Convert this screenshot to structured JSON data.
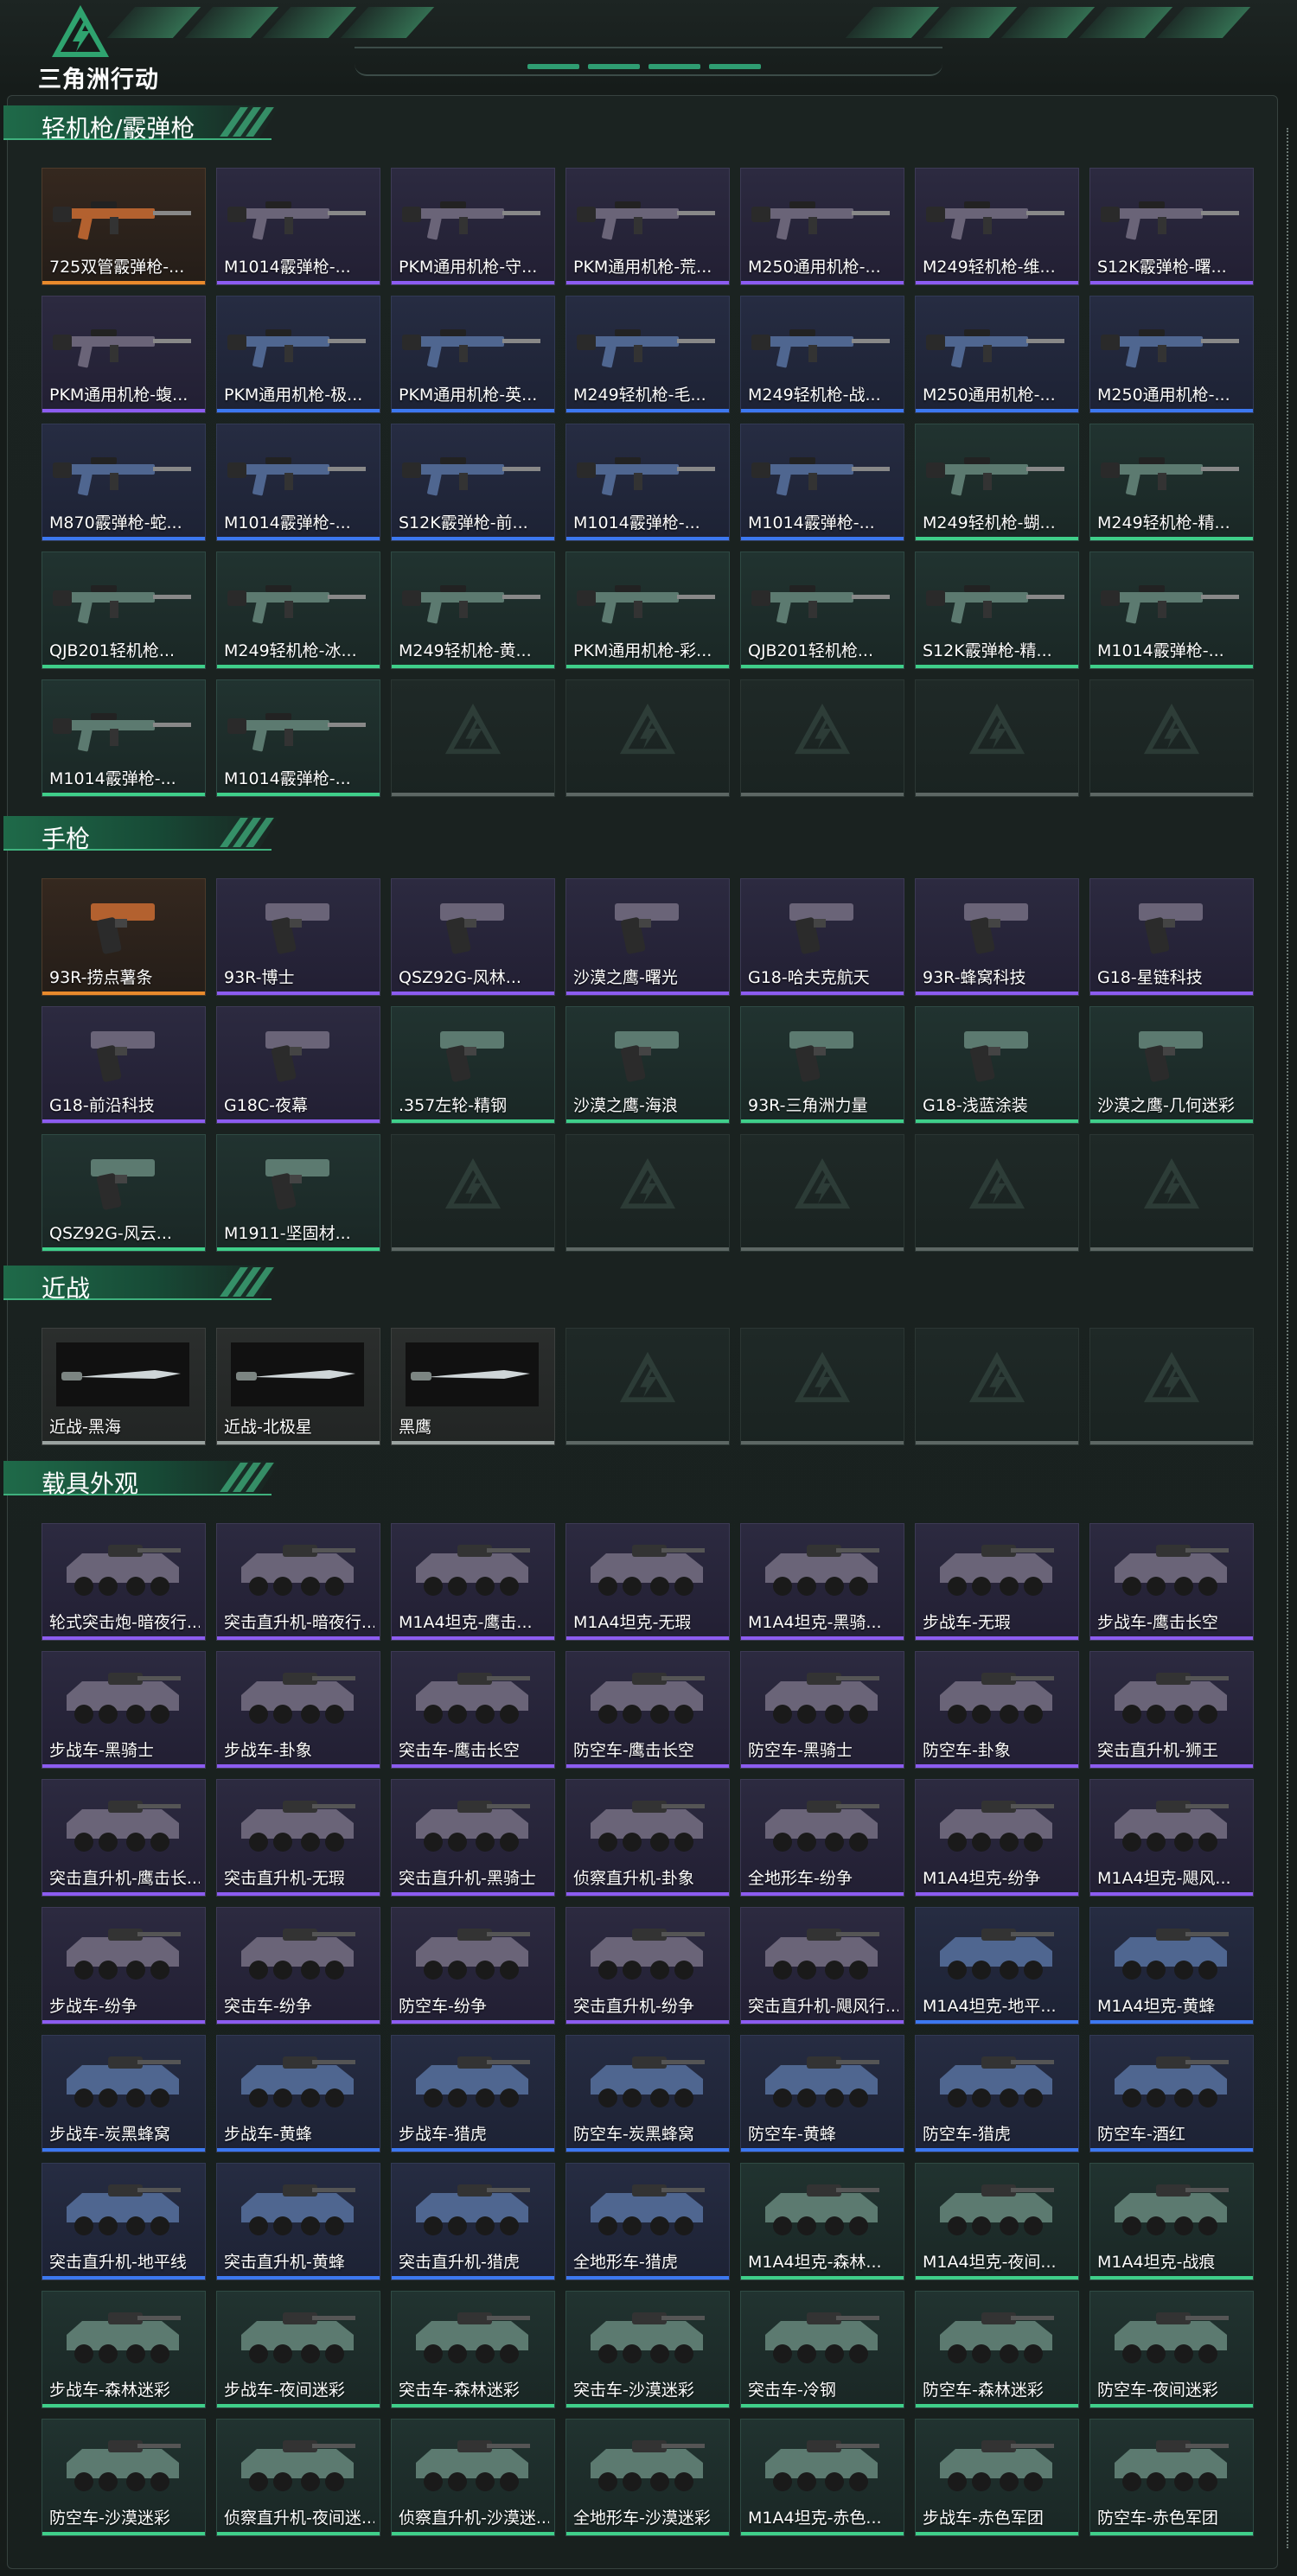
{
  "header": {
    "logo_text": "三角洲行动"
  },
  "colors": {
    "accent_green": "#3fb07d",
    "rarity_purple": "#8c5cf0",
    "rarity_blue": "#3c78f0",
    "rarity_green": "#3fcf8a",
    "rarity_orange": "#e88a2c"
  },
  "sections": [
    {
      "title": "轻机枪/霰弹枪",
      "icon": "rifle",
      "items": [
        {
          "name": "725双管霰弹枪-...",
          "rarity": "orange"
        },
        {
          "name": "M1014霰弹枪-...",
          "rarity": "purple"
        },
        {
          "name": "PKM通用机枪-守...",
          "rarity": "purple"
        },
        {
          "name": "PKM通用机枪-荒...",
          "rarity": "purple"
        },
        {
          "name": "M250通用机枪-...",
          "rarity": "purple"
        },
        {
          "name": "M249轻机枪-维...",
          "rarity": "purple"
        },
        {
          "name": "S12K霰弹枪-曙...",
          "rarity": "purple"
        },
        {
          "name": "PKM通用机枪-蝮...",
          "rarity": "purple"
        },
        {
          "name": "PKM通用机枪-极...",
          "rarity": "blue"
        },
        {
          "name": "PKM通用机枪-英...",
          "rarity": "blue"
        },
        {
          "name": "M249轻机枪-毛...",
          "rarity": "blue"
        },
        {
          "name": "M249轻机枪-战...",
          "rarity": "blue"
        },
        {
          "name": "M250通用机枪-...",
          "rarity": "blue"
        },
        {
          "name": "M250通用机枪-...",
          "rarity": "blue"
        },
        {
          "name": "M870霰弹枪-蛇...",
          "rarity": "blue"
        },
        {
          "name": "M1014霰弹枪-...",
          "rarity": "blue"
        },
        {
          "name": "S12K霰弹枪-前...",
          "rarity": "blue"
        },
        {
          "name": "M1014霰弹枪-...",
          "rarity": "blue"
        },
        {
          "name": "M1014霰弹枪-...",
          "rarity": "blue"
        },
        {
          "name": "M249轻机枪-蝴...",
          "rarity": "green"
        },
        {
          "name": "M249轻机枪-精...",
          "rarity": "green"
        },
        {
          "name": "QJB201轻机枪...",
          "rarity": "green"
        },
        {
          "name": "M249轻机枪-冰...",
          "rarity": "green"
        },
        {
          "name": "M249轻机枪-黄...",
          "rarity": "green"
        },
        {
          "name": "PKM通用机枪-彩...",
          "rarity": "green"
        },
        {
          "name": "QJB201轻机枪...",
          "rarity": "green"
        },
        {
          "name": "S12K霰弹枪-精...",
          "rarity": "green"
        },
        {
          "name": "M1014霰弹枪-...",
          "rarity": "green"
        },
        {
          "name": "M1014霰弹枪-...",
          "rarity": "green"
        },
        {
          "name": "M1014霰弹枪-...",
          "rarity": "green"
        }
      ],
      "empty_slots": 5
    },
    {
      "title": "手枪",
      "icon": "pistol",
      "items": [
        {
          "name": "93R-捞点薯条",
          "rarity": "orange"
        },
        {
          "name": "93R-博士",
          "rarity": "purple"
        },
        {
          "name": "QSZ92G-风林...",
          "rarity": "purple"
        },
        {
          "name": "沙漠之鹰-曙光",
          "rarity": "purple"
        },
        {
          "name": "G18-哈夫克航天",
          "rarity": "purple"
        },
        {
          "name": "93R-蜂窝科技",
          "rarity": "purple"
        },
        {
          "name": "G18-星链科技",
          "rarity": "purple"
        },
        {
          "name": "G18-前沿科技",
          "rarity": "purple"
        },
        {
          "name": "G18C-夜幕",
          "rarity": "purple"
        },
        {
          "name": ".357左轮-精钢",
          "rarity": "green"
        },
        {
          "name": "沙漠之鹰-海浪",
          "rarity": "green"
        },
        {
          "name": "93R-三角洲力量",
          "rarity": "green"
        },
        {
          "name": "G18-浅蓝涂装",
          "rarity": "green"
        },
        {
          "name": "沙漠之鹰-几何迷彩",
          "rarity": "green"
        },
        {
          "name": "QSZ92G-风云...",
          "rarity": "green"
        },
        {
          "name": "M1911-坚固材...",
          "rarity": "green"
        }
      ],
      "empty_slots": 5
    },
    {
      "title": "近战",
      "icon": "knife",
      "items": [
        {
          "name": "近战-黑海",
          "rarity": "gray"
        },
        {
          "name": "近战-北极星",
          "rarity": "gray"
        },
        {
          "name": "黑鹰",
          "rarity": "gray"
        }
      ],
      "empty_slots": 4
    },
    {
      "title": "载具外观",
      "icon": "vehicle",
      "items": [
        {
          "name": "轮式突击炮-暗夜行...",
          "rarity": "purple"
        },
        {
          "name": "突击直升机-暗夜行...",
          "rarity": "purple"
        },
        {
          "name": "M1A4坦克-鹰击...",
          "rarity": "purple"
        },
        {
          "name": "M1A4坦克-无瑕",
          "rarity": "purple"
        },
        {
          "name": "M1A4坦克-黑骑...",
          "rarity": "purple"
        },
        {
          "name": "步战车-无瑕",
          "rarity": "purple"
        },
        {
          "name": "步战车-鹰击长空",
          "rarity": "purple"
        },
        {
          "name": "步战车-黑骑士",
          "rarity": "purple"
        },
        {
          "name": "步战车-卦象",
          "rarity": "purple"
        },
        {
          "name": "突击车-鹰击长空",
          "rarity": "purple"
        },
        {
          "name": "防空车-鹰击长空",
          "rarity": "purple"
        },
        {
          "name": "防空车-黑骑士",
          "rarity": "purple"
        },
        {
          "name": "防空车-卦象",
          "rarity": "purple"
        },
        {
          "name": "突击直升机-狮王",
          "rarity": "purple"
        },
        {
          "name": "突击直升机-鹰击长...",
          "rarity": "purple"
        },
        {
          "name": "突击直升机-无瑕",
          "rarity": "purple"
        },
        {
          "name": "突击直升机-黑骑士",
          "rarity": "purple"
        },
        {
          "name": "侦察直升机-卦象",
          "rarity": "purple"
        },
        {
          "name": "全地形车-纷争",
          "rarity": "purple"
        },
        {
          "name": "M1A4坦克-纷争",
          "rarity": "purple"
        },
        {
          "name": "M1A4坦克-飓风...",
          "rarity": "purple"
        },
        {
          "name": "步战车-纷争",
          "rarity": "purple"
        },
        {
          "name": "突击车-纷争",
          "rarity": "purple"
        },
        {
          "name": "防空车-纷争",
          "rarity": "purple"
        },
        {
          "name": "突击直升机-纷争",
          "rarity": "purple"
        },
        {
          "name": "突击直升机-飓风行...",
          "rarity": "purple"
        },
        {
          "name": "M1A4坦克-地平...",
          "rarity": "blue"
        },
        {
          "name": "M1A4坦克-黄蜂",
          "rarity": "blue"
        },
        {
          "name": "步战车-炭黑蜂窝",
          "rarity": "blue"
        },
        {
          "name": "步战车-黄蜂",
          "rarity": "blue"
        },
        {
          "name": "步战车-猎虎",
          "rarity": "blue"
        },
        {
          "name": "防空车-炭黑蜂窝",
          "rarity": "blue"
        },
        {
          "name": "防空车-黄蜂",
          "rarity": "blue"
        },
        {
          "name": "防空车-猎虎",
          "rarity": "blue"
        },
        {
          "name": "防空车-酒红",
          "rarity": "blue"
        },
        {
          "name": "突击直升机-地平线",
          "rarity": "blue"
        },
        {
          "name": "突击直升机-黄蜂",
          "rarity": "blue"
        },
        {
          "name": "突击直升机-猎虎",
          "rarity": "blue"
        },
        {
          "name": "全地形车-猎虎",
          "rarity": "blue"
        },
        {
          "name": "M1A4坦克-森林...",
          "rarity": "green"
        },
        {
          "name": "M1A4坦克-夜间...",
          "rarity": "green"
        },
        {
          "name": "M1A4坦克-战痕",
          "rarity": "green"
        },
        {
          "name": "步战车-森林迷彩",
          "rarity": "green"
        },
        {
          "name": "步战车-夜间迷彩",
          "rarity": "green"
        },
        {
          "name": "突击车-森林迷彩",
          "rarity": "green"
        },
        {
          "name": "突击车-沙漠迷彩",
          "rarity": "green"
        },
        {
          "name": "突击车-冷钢",
          "rarity": "green"
        },
        {
          "name": "防空车-森林迷彩",
          "rarity": "green"
        },
        {
          "name": "防空车-夜间迷彩",
          "rarity": "green"
        },
        {
          "name": "防空车-沙漠迷彩",
          "rarity": "green"
        },
        {
          "name": "侦察直升机-夜间迷...",
          "rarity": "green"
        },
        {
          "name": "侦察直升机-沙漠迷...",
          "rarity": "green"
        },
        {
          "name": "全地形车-沙漠迷彩",
          "rarity": "green"
        },
        {
          "name": "M1A4坦克-赤色...",
          "rarity": "green"
        },
        {
          "name": "步战车-赤色军团",
          "rarity": "green"
        },
        {
          "name": "防空车-赤色军团",
          "rarity": "green"
        }
      ],
      "empty_slots": 0
    }
  ]
}
